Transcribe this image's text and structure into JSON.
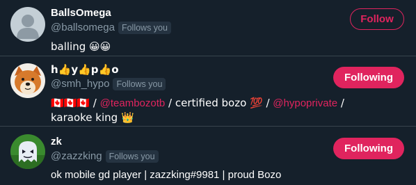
{
  "users": [
    {
      "name": "BallsOmega",
      "handle": "@ballsomega",
      "follows_badge": "Follows you",
      "bio_text": "balling 😀😀",
      "button_label": "Follow",
      "button_style": "outline",
      "avatar_icon": "default-avatar-icon"
    },
    {
      "name": "h👍y👍p👍o",
      "handle": "@smh_hypo",
      "follows_badge": "Follows you",
      "bio_parts": {
        "flags": "🇨🇦🇨🇦🇨🇦 / ",
        "mention1": "@teambozotb",
        "middle": " / certified bozo 💯 / ",
        "mention2": "@hypoprivate",
        "end": " / karaoke king 👑"
      },
      "button_label": "Following",
      "button_style": "filled",
      "avatar_icon": "dog-avatar-icon"
    },
    {
      "name": "zk",
      "handle": "@zazzking",
      "follows_badge": "Follows you",
      "bio_text": "ok mobile gd player | zazzking#9981 | proud Bozo",
      "button_label": "Following",
      "button_style": "filled",
      "avatar_icon": "ghost-avatar-icon"
    }
  ],
  "colors": {
    "background": "#15202b",
    "accent": "#e0245e",
    "secondary_text": "#8899a6",
    "divider": "#38444d",
    "badge_bg": "#253341"
  }
}
